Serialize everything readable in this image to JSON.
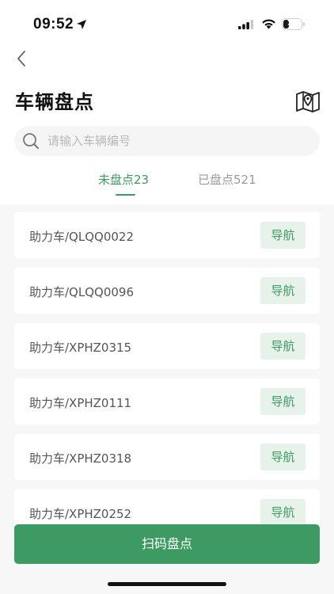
{
  "status_bar": {
    "time": "09:52",
    "battery": "37",
    "battery_level": 0.37
  },
  "header": {
    "title": "车辆盘点",
    "back_icon": "chevron-left-icon",
    "map_icon": "map-pin-icon"
  },
  "search": {
    "placeholder": "请输入车辆编号",
    "value": ""
  },
  "tabs": [
    {
      "label": "未盘点23",
      "active": true
    },
    {
      "label": "已盘点521",
      "active": false
    }
  ],
  "vehicles": [
    {
      "label": "助力车/QLQQ0022",
      "action": "导航"
    },
    {
      "label": "助力车/QLQQ0096",
      "action": "导航"
    },
    {
      "label": "助力车/XPHZ0315",
      "action": "导航"
    },
    {
      "label": "助力车/XPHZ0111",
      "action": "导航"
    },
    {
      "label": "助力车/XPHZ0318",
      "action": "导航"
    },
    {
      "label": "助力车/XPHZ0252",
      "action": "导航"
    }
  ],
  "scan_button": "扫码盘点",
  "colors": {
    "accent": "#3e9a63",
    "accent_light": "#e6f2ea",
    "background": "#f7f7f7"
  }
}
